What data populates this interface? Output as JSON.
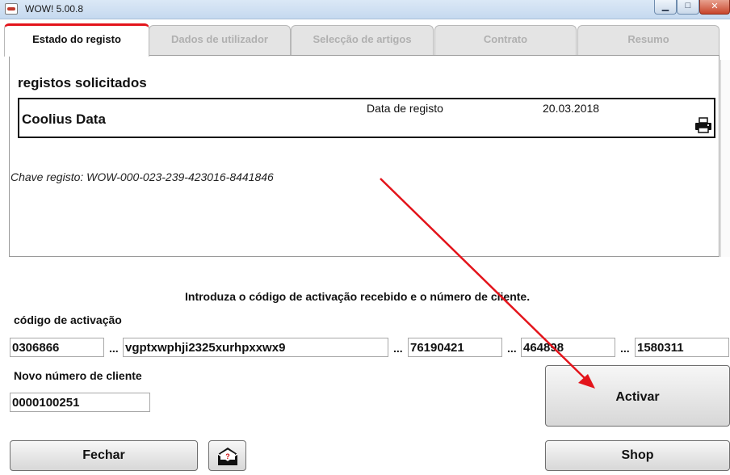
{
  "window": {
    "title": "WOW! 5.00.8"
  },
  "window_controls": {
    "minimize": "▁",
    "maximize": "□",
    "close": "✕"
  },
  "tabs": [
    {
      "label": "Estado do registo",
      "active": true
    },
    {
      "label": "Dados de utilizador",
      "active": false
    },
    {
      "label": "Selecção de artigos",
      "active": false
    },
    {
      "label": "Contrato",
      "active": false
    },
    {
      "label": "Resumo",
      "active": false
    }
  ],
  "registration": {
    "section_title": "registos solicitados",
    "company": "Coolius Data",
    "date_label": "Data de registo",
    "date_value": "20.03.2018",
    "key_text": "Chave registo: WOW-000-023-239-423016-8441846"
  },
  "activation": {
    "instruction": "Introduza o código de activação recebido e o número de cliente.",
    "code_label": "código de activação",
    "separator": "...",
    "code_fields": [
      "0306866",
      "vgptxwphji2325xurhpxxwx9",
      "76190421",
      "464898",
      "1580311"
    ],
    "client_label": "Novo número de cliente",
    "client_number": "0000100251"
  },
  "buttons": {
    "activate": "Activar",
    "close": "Fechar",
    "shop": "Shop"
  },
  "icons": {
    "app": "wow-app-icon",
    "printer": "printer-icon",
    "mail": "mail-help-icon"
  },
  "colors": {
    "active_tab_accent": "#e3141b",
    "annotation_arrow": "#e3141b"
  }
}
